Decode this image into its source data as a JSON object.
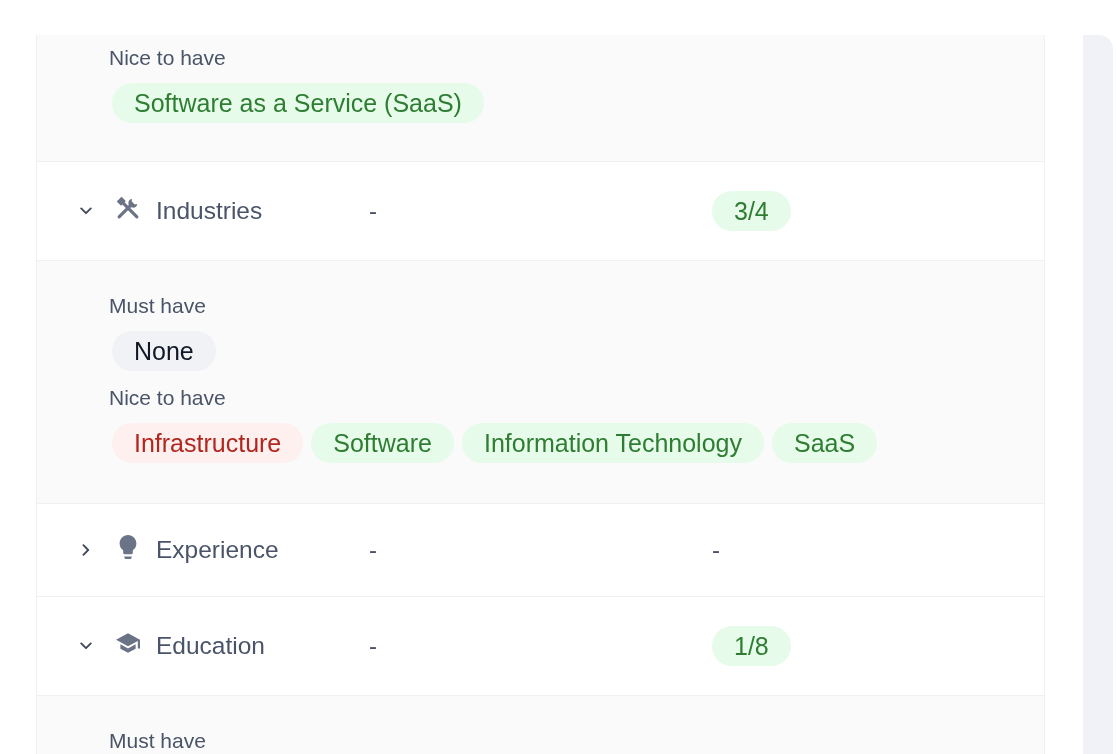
{
  "previous_section_detail": {
    "groups": [
      {
        "label": "Nice to have",
        "chips": [
          {
            "text": "Software as a Service (SaaS)",
            "color": "#2e7d32"
          }
        ]
      }
    ]
  },
  "criteria": [
    {
      "name": "Industries",
      "expanded": true,
      "column_2": "-",
      "match": {
        "kind": "badge",
        "text": "3/4"
      },
      "groups": [
        {
          "label": "Must have",
          "chips": [
            {
              "text": "None",
              "color": "#111827"
            }
          ]
        },
        {
          "label": "Nice to have",
          "chips": [
            {
              "text": "Infrastructure",
              "color": "#b3261e"
            },
            {
              "text": "Software",
              "color": "#2e7d32"
            },
            {
              "text": "Information Technology",
              "color": "#2e7d32"
            },
            {
              "text": "SaaS",
              "color": "#2e7d32"
            }
          ]
        }
      ]
    },
    {
      "name": "Experience",
      "expanded": false,
      "column_2": "-",
      "match": {
        "kind": "plain",
        "text": "-"
      }
    },
    {
      "name": "Education",
      "expanded": true,
      "column_2": "-",
      "match": {
        "kind": "badge",
        "text": "1/8"
      },
      "groups": [
        {
          "label": "Must have"
        }
      ]
    }
  ]
}
